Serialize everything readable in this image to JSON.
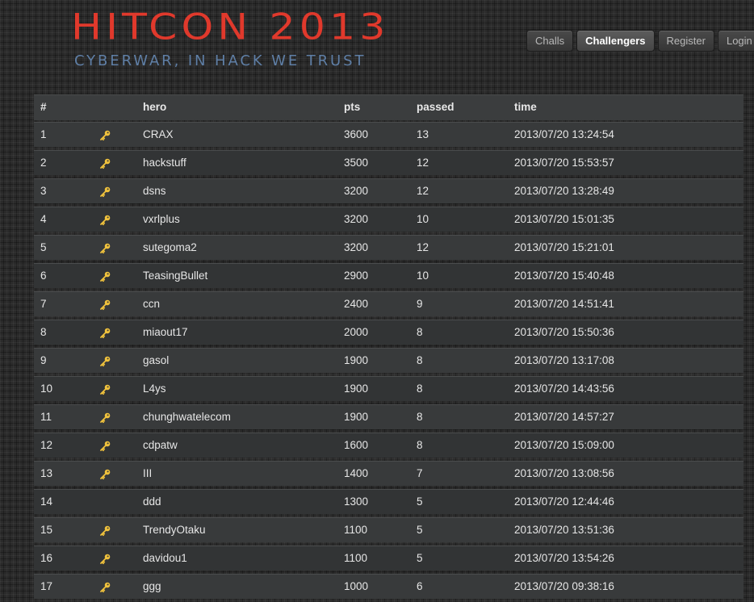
{
  "logo": {
    "title": "HITCON 2013",
    "subtitle": "CYBERWAR, IN HACK WE TRUST",
    "title_color": "#e0392c",
    "subtitle_color": "#5f7fa6"
  },
  "nav": {
    "items": [
      {
        "label": "Challs",
        "active": false
      },
      {
        "label": "Challengers",
        "active": true
      },
      {
        "label": "Register",
        "active": false
      },
      {
        "label": "Login",
        "active": false
      }
    ]
  },
  "table": {
    "headers": {
      "rank": "#",
      "hero": "hero",
      "pts": "pts",
      "passed": "passed",
      "time": "time"
    },
    "rows": [
      {
        "rank": "1",
        "key": true,
        "hero": "CRAX",
        "pts": "3600",
        "passed": "13",
        "time": "2013/07/20 13:24:54"
      },
      {
        "rank": "2",
        "key": true,
        "hero": "hackstuff",
        "pts": "3500",
        "passed": "12",
        "time": "2013/07/20 15:53:57"
      },
      {
        "rank": "3",
        "key": true,
        "hero": "dsns",
        "pts": "3200",
        "passed": "12",
        "time": "2013/07/20 13:28:49"
      },
      {
        "rank": "4",
        "key": true,
        "hero": "vxrlplus",
        "pts": "3200",
        "passed": "10",
        "time": "2013/07/20 15:01:35"
      },
      {
        "rank": "5",
        "key": true,
        "hero": "sutegoma2",
        "pts": "3200",
        "passed": "12",
        "time": "2013/07/20 15:21:01"
      },
      {
        "rank": "6",
        "key": true,
        "hero": "TeasingBullet",
        "pts": "2900",
        "passed": "10",
        "time": "2013/07/20 15:40:48"
      },
      {
        "rank": "7",
        "key": true,
        "hero": "ccn",
        "pts": "2400",
        "passed": "9",
        "time": "2013/07/20 14:51:41"
      },
      {
        "rank": "8",
        "key": true,
        "hero": "miaout17",
        "pts": "2000",
        "passed": "8",
        "time": "2013/07/20 15:50:36"
      },
      {
        "rank": "9",
        "key": true,
        "hero": "gasol",
        "pts": "1900",
        "passed": "8",
        "time": "2013/07/20 13:17:08"
      },
      {
        "rank": "10",
        "key": true,
        "hero": "L4ys",
        "pts": "1900",
        "passed": "8",
        "time": "2013/07/20 14:43:56"
      },
      {
        "rank": "11",
        "key": true,
        "hero": "chunghwatelecom",
        "pts": "1900",
        "passed": "8",
        "time": "2013/07/20 14:57:27"
      },
      {
        "rank": "12",
        "key": true,
        "hero": "cdpatw",
        "pts": "1600",
        "passed": "8",
        "time": "2013/07/20 15:09:00"
      },
      {
        "rank": "13",
        "key": true,
        "hero": "III",
        "pts": "1400",
        "passed": "7",
        "time": "2013/07/20 13:08:56"
      },
      {
        "rank": "14",
        "key": false,
        "hero": "ddd",
        "pts": "1300",
        "passed": "5",
        "time": "2013/07/20 12:44:46"
      },
      {
        "rank": "15",
        "key": true,
        "hero": "TrendyOtaku",
        "pts": "1100",
        "passed": "5",
        "time": "2013/07/20 13:51:36"
      },
      {
        "rank": "16",
        "key": true,
        "hero": "davidou1",
        "pts": "1100",
        "passed": "5",
        "time": "2013/07/20 13:54:26"
      },
      {
        "rank": "17",
        "key": true,
        "hero": "ggg",
        "pts": "1000",
        "passed": "6",
        "time": "2013/07/20 09:38:16"
      }
    ]
  },
  "icons": {
    "key": "key-icon",
    "key_color": "#f0c23c"
  }
}
